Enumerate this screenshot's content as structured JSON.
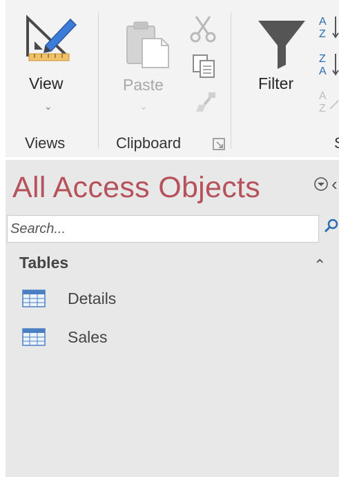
{
  "ribbon": {
    "views_group": {
      "view_label": "View",
      "group_label": "Views"
    },
    "clipboard_group": {
      "paste_label": "Paste",
      "group_label": "Clipboard"
    },
    "sort_filter_group": {
      "filter_label": "Filter",
      "group_label_partial": "S"
    }
  },
  "nav_pane": {
    "title": "All Access Objects",
    "search_placeholder": "Search...",
    "groups": [
      {
        "label": "Tables",
        "items": [
          {
            "label": "Details"
          },
          {
            "label": "Sales"
          }
        ]
      }
    ]
  },
  "icons": [
    "view-icon",
    "paste-icon",
    "cut-icon",
    "copy-icon",
    "format-painter-icon",
    "filter-icon",
    "sort-ascending-icon",
    "sort-descending-icon",
    "remove-sort-icon",
    "dialog-launcher-icon",
    "nav-menu-icon",
    "shutter-icon",
    "search-icon",
    "collapse-icon",
    "table-icon"
  ],
  "colors": {
    "nav_title": "#b5525b",
    "ribbon_bg": "#f3f3f3",
    "nav_bg": "#e8e8e8",
    "accent_blue": "#2b6cb0"
  }
}
